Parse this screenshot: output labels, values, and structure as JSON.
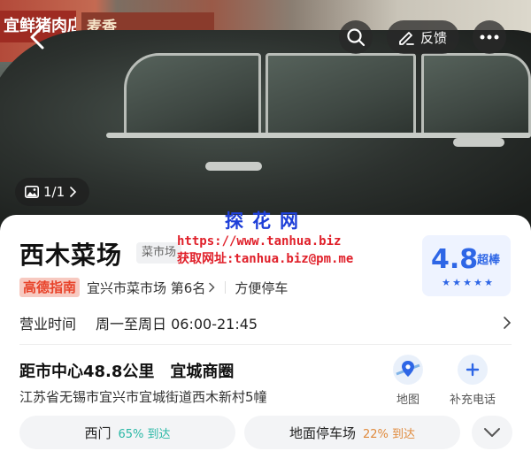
{
  "header": {
    "feedback_label": "反馈",
    "photo_counter": "1/1"
  },
  "hero_signs": {
    "left_sign": "宜鲜猪肉店",
    "middle_sign": "麦香"
  },
  "watermark": {
    "title": "探花网",
    "url": "https://www.tanhua.biz",
    "contact": "获取网址:tanhua.biz@pm.me"
  },
  "place": {
    "name": "西木菜场",
    "category_tag": "菜市场"
  },
  "rank": {
    "brand_badge": "高德指南",
    "rank_text": "宜兴市菜市场 第6名",
    "extra_tag": "方便停车"
  },
  "score": {
    "value": "4.8",
    "word": "超棒",
    "stars": 5
  },
  "hours": {
    "label": "营业时间",
    "value": "周一至周日 06:00-21:45"
  },
  "location": {
    "distance": "距市中心48.8公里",
    "area": "宜城商圈",
    "address": "江苏省无锡市宜兴市宜城街道西木新村5幢"
  },
  "actions": [
    {
      "label": "地图",
      "icon": "map-pin-icon"
    },
    {
      "label": "补充电话",
      "icon": "plus-icon"
    }
  ],
  "entrances": [
    {
      "name": "西门",
      "pct": "65% 到达",
      "color": "#2bb8a6"
    },
    {
      "name": "地面停车场",
      "pct": "22% 到达",
      "color": "#e08a3c"
    }
  ],
  "colors": {
    "accent": "#2e66e6",
    "brand_red": "#e8432a",
    "watermark_blue": "#1e3fd8",
    "watermark_red": "#e0202a"
  }
}
